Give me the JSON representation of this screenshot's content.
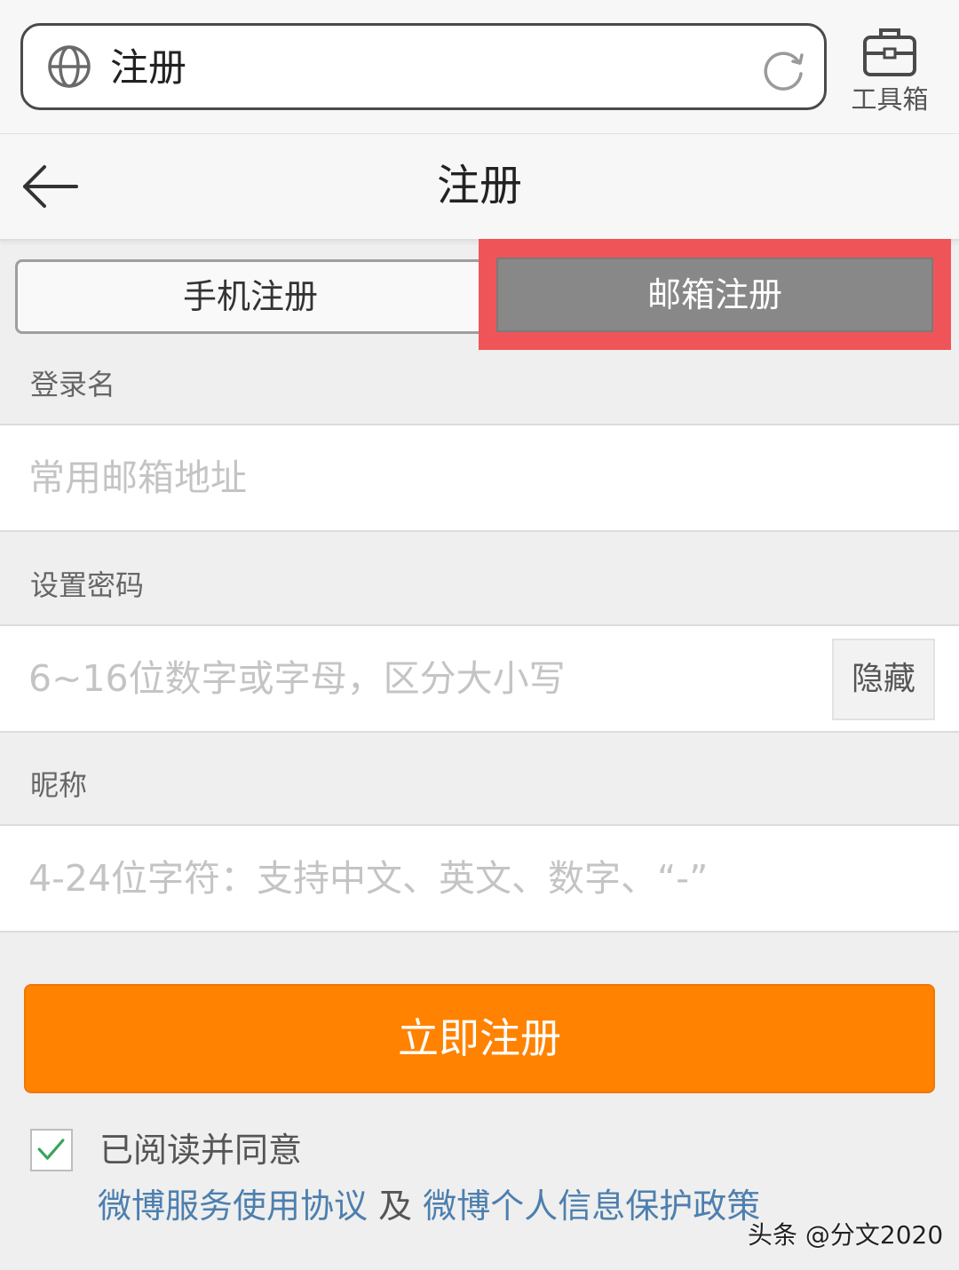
{
  "browser": {
    "url_text": "注册",
    "toolbox_label": "工具箱"
  },
  "nav": {
    "title": "注册"
  },
  "tabs": [
    {
      "label": "手机注册",
      "active": false
    },
    {
      "label": "邮箱注册",
      "active": true
    }
  ],
  "form": {
    "login_label": "登录名",
    "login_placeholder": "常用邮箱地址",
    "password_label": "设置密码",
    "password_placeholder": "6~16位数字或字母，区分大小写",
    "password_toggle": "隐藏",
    "nickname_label": "昵称",
    "nickname_placeholder": "4-24位字符：支持中文、英文、数字、“-”"
  },
  "submit_label": "立即注册",
  "agreement": {
    "checked": true,
    "text": "已阅读并同意",
    "link1": "微博服务使用协议",
    "conjunction": " 及 ",
    "link2": "微博个人信息保护政策"
  },
  "watermark": "头条 @分文2020",
  "colors": {
    "accent_orange": "#ff8200",
    "highlight_red": "#ef5558",
    "active_tab_gray": "#888888",
    "link_blue": "#4d7fae",
    "checkmark_green": "#3aa35a"
  }
}
